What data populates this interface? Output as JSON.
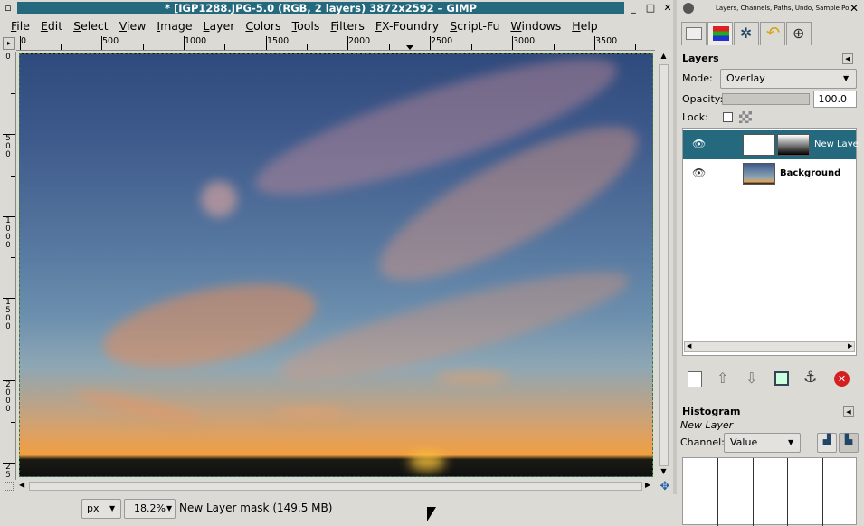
{
  "window": {
    "title": "* [IGP1288.JPG-5.0 (RGB, 2 layers) 3872x2592 – GIMP",
    "min_icon": "minimize-icon",
    "max_icon": "maximize-icon",
    "close_icon": "close-icon",
    "close_glyph": "✕",
    "min_glyph": "_",
    "max_glyph": "□"
  },
  "menu": [
    "File",
    "Edit",
    "Select",
    "View",
    "Image",
    "Layer",
    "Colors",
    "Tools",
    "Filters",
    "FX-Foundry",
    "Script-Fu",
    "Windows",
    "Help"
  ],
  "ruler": {
    "h_labels": [
      "0",
      "500",
      "1000",
      "1500",
      "2000",
      "2500",
      "3000",
      "3500"
    ],
    "v_labels": [
      "0",
      "5\n0\n0",
      "1\n0\n0\n0",
      "1\n5\n0\n0",
      "2\n0\n0\n0",
      "2\n5"
    ]
  },
  "status": {
    "unit": "px",
    "zoom": "18.2%",
    "message": "New Layer mask (149.5 MB)"
  },
  "dock": {
    "title": "Layers, Channels, Paths, Undo, Sample Po",
    "close_glyph": "✕",
    "layers": {
      "heading": "Layers",
      "mode_label": "Mode:",
      "mode_value": "Overlay",
      "opacity_label": "Opacity:",
      "opacity_value": "100.0",
      "opacity_fraction": 1.0,
      "lock_label": "Lock:",
      "items": [
        {
          "name": "New Laye",
          "selected": true,
          "visible": true
        },
        {
          "name": "Background",
          "selected": false,
          "visible": true
        }
      ]
    },
    "histogram": {
      "heading": "Histogram",
      "layer": "New Layer",
      "channel_label": "Channel:",
      "channel_value": "Value"
    }
  },
  "colors": {
    "title_bg": "#25697f",
    "selection": "#25697f",
    "delete": "#d42020"
  }
}
